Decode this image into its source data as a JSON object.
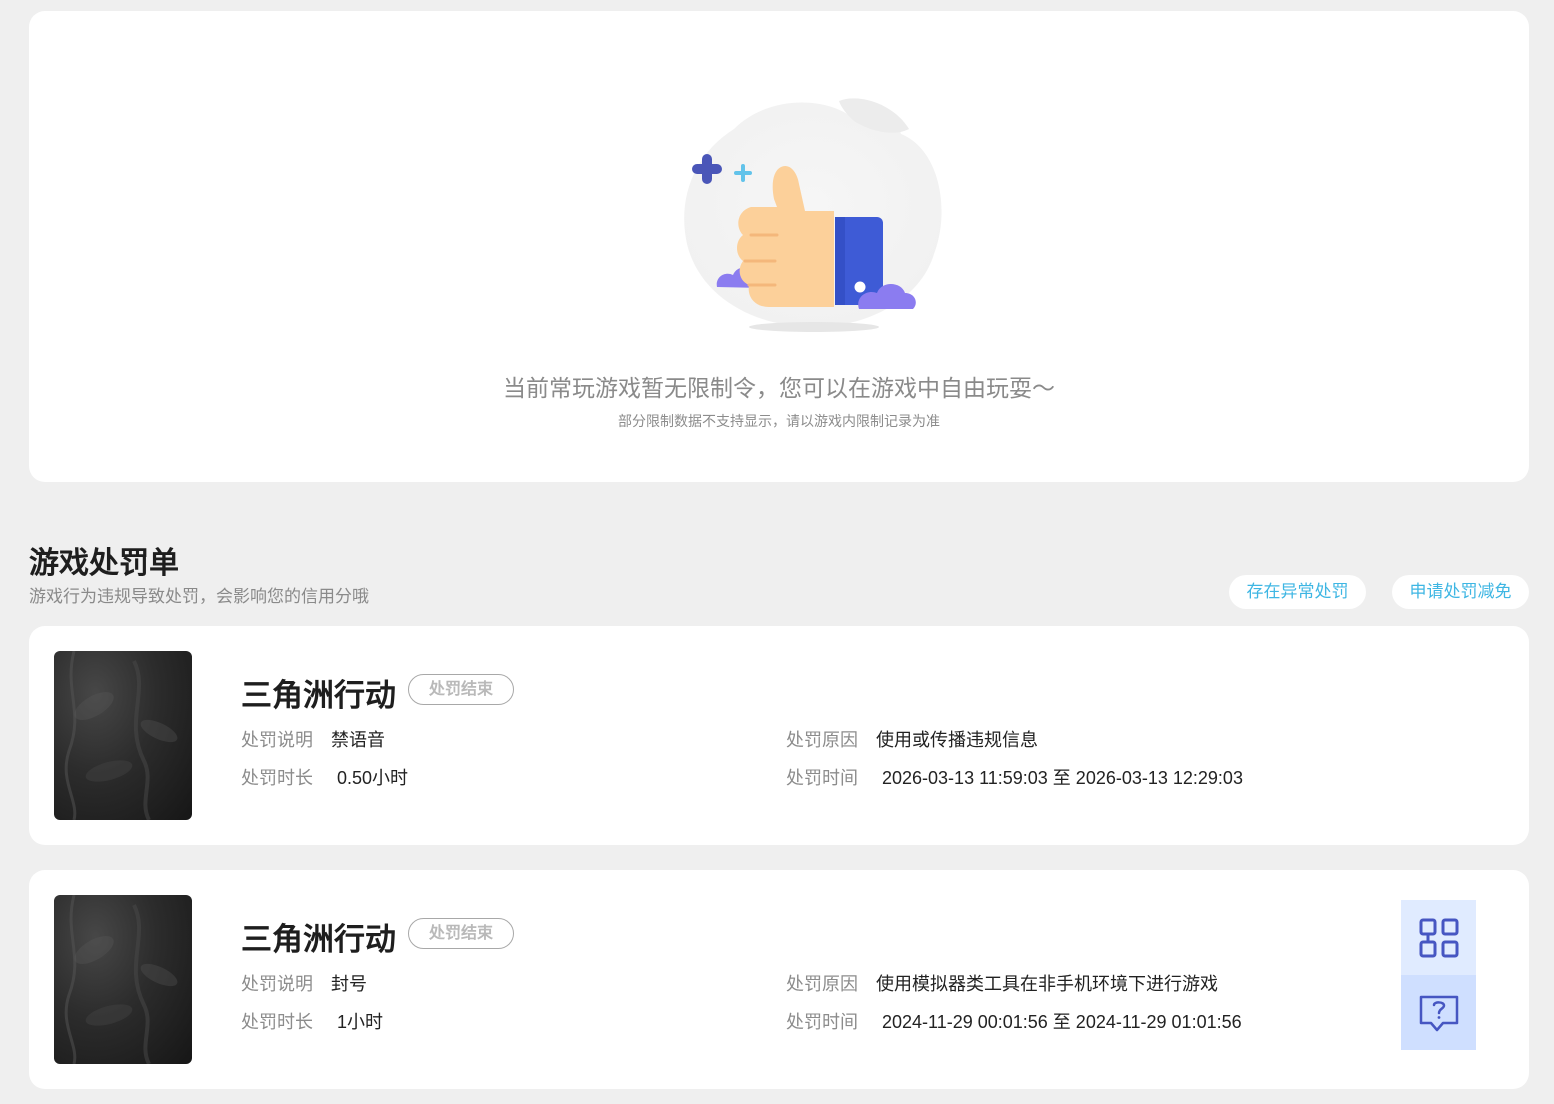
{
  "empty_state": {
    "title": "当前常玩游戏暂无限制令，您可以在游戏中自由玩耍～",
    "subtitle": "部分限制数据不支持显示，请以游戏内限制记录为准"
  },
  "penalty_section": {
    "title": "游戏处罚单",
    "subtitle": "游戏行为违规导致处罚，会影响您的信用分哦",
    "abnormal_button": "存在异常处罚",
    "reduce_button": "申请处罚减免"
  },
  "penalties": [
    {
      "game": "三角洲行动",
      "status": "处罚结束",
      "desc_label": "处罚说明",
      "desc": "禁语音",
      "reason_label": "处罚原因",
      "reason": "使用或传播违规信息",
      "duration_label": "处罚时长",
      "duration": "0.50小时",
      "time_label": "处罚时间",
      "time": "2026-03-13 11:59:03 至 2026-03-13 12:29:03"
    },
    {
      "game": "三角洲行动",
      "status": "处罚结束",
      "desc_label": "处罚说明",
      "desc": "封号",
      "reason_label": "处罚原因",
      "reason": "使用模拟器类工具在非手机环境下进行游戏",
      "duration_label": "处罚时长",
      "duration": "1小时",
      "time_label": "处罚时间",
      "time": "2024-11-29 00:01:56 至 2024-11-29 01:01:56"
    }
  ],
  "float_tools": [
    {
      "icon": "qr-code-icon"
    },
    {
      "icon": "help-chat-icon"
    }
  ],
  "colors": {
    "accent": "#3eb6e3",
    "page_bg": "#efefef",
    "thumb_blue": "#3e5bd6",
    "float_bg": "#e0ebff"
  }
}
